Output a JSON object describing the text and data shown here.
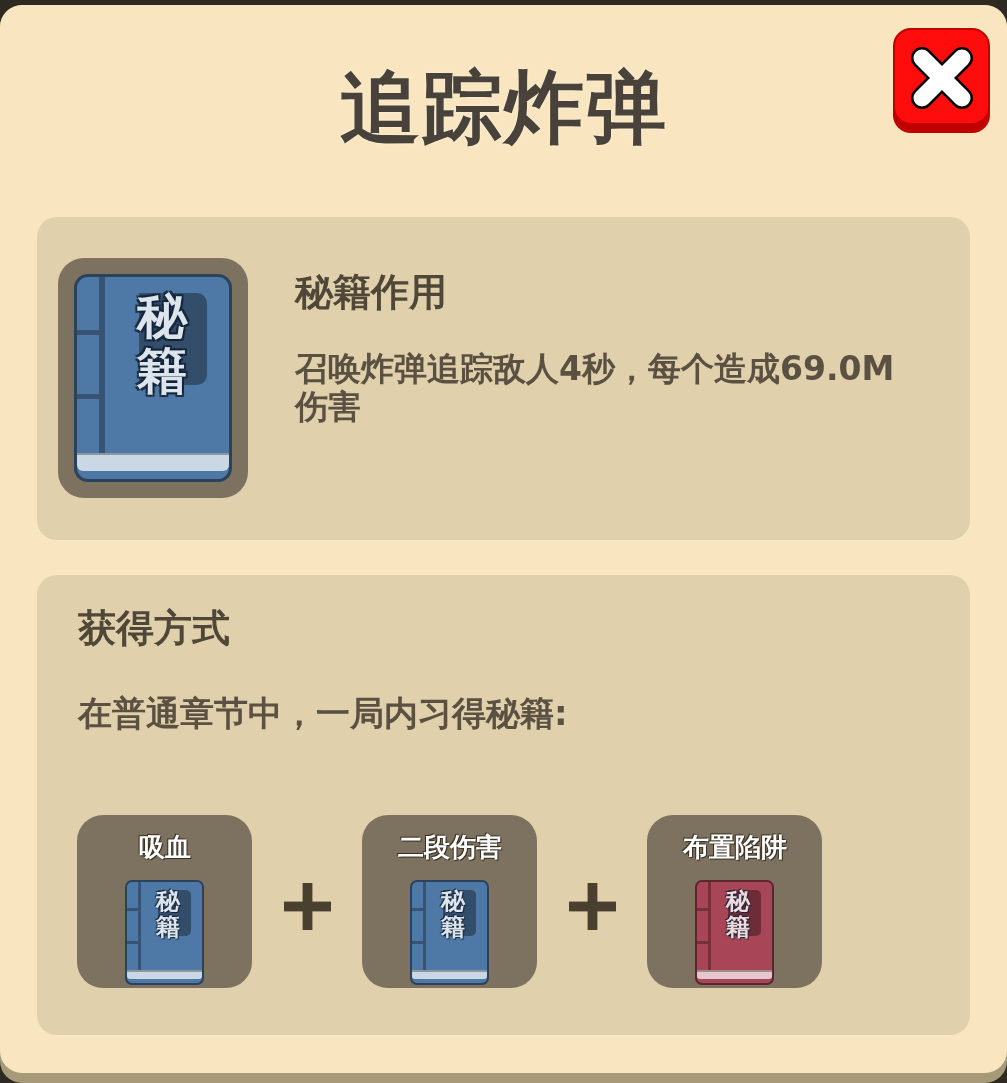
{
  "dialog": {
    "title": "追踪炸弹"
  },
  "effect": {
    "book": {
      "label": "秘籍",
      "color": "#4e78a5"
    },
    "heading": "秘籍作用",
    "description": "召唤炸弹追踪敌人4秒，每个造成69.0M伤害"
  },
  "acquire": {
    "heading": "获得方式",
    "instruction": "在普通章节中，一局内习得秘籍:",
    "recipe": [
      {
        "name": "吸血",
        "book": {
          "label": "秘籍",
          "color": "#4e78a5"
        }
      },
      {
        "name": "二段伤害",
        "book": {
          "label": "秘籍",
          "color": "#4e78a5"
        }
      },
      {
        "name": "布置陷阱",
        "book": {
          "label": "秘籍",
          "color": "#a84657"
        }
      }
    ]
  }
}
